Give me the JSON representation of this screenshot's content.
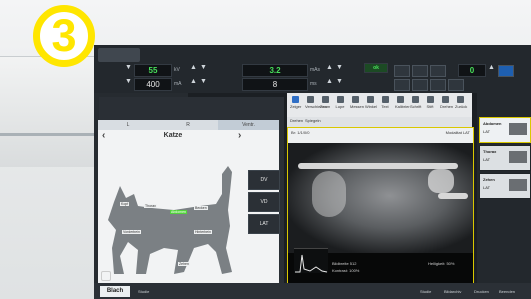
{
  "badge": {
    "number": "3"
  },
  "exposure": {
    "kv_value": "55",
    "kv_unit": "kV",
    "ma_value": "400",
    "ma_unit": "mA",
    "mas_value": "3.2",
    "mas_unit": "mAs",
    "ms_value": "8",
    "ms_unit": "ms",
    "ok_label": "ok",
    "right_value": "0",
    "right_unit": "m"
  },
  "species_panel": {
    "title": "Katze",
    "view_tabs": [
      "L",
      "R",
      "Ventr."
    ],
    "positions": [
      "DV",
      "VD",
      "LAT"
    ],
    "labels": [
      "Kopf",
      "Thorax",
      "Abdomen",
      "Becken",
      "Zehen",
      "Vorderbein",
      "Hinterbein"
    ]
  },
  "toolbar": {
    "tools": [
      "Zeiger",
      "Verschieben",
      "Zoom",
      "Lupe",
      "Messen",
      "Winkel",
      "Text",
      "Kalibrier.",
      "Schrift",
      "Stift",
      "Drehen",
      "Zurück"
    ],
    "secondary": [
      "Drehen",
      "Spiegeln"
    ]
  },
  "viewer": {
    "header_left": "Br: 1/1/0/0",
    "header_right": "Modalitat LAT",
    "stats_left": "Bildbreite 512",
    "stats_mid": "Kontrast: 100%",
    "stats_right": "Helligkeit: 50%"
  },
  "thumbnails": [
    {
      "title": "Abdomen",
      "view": "LAT",
      "selected": true
    },
    {
      "title": "Thorax",
      "view": "LAT",
      "selected": false
    },
    {
      "title": "Zehen",
      "view": "LAT",
      "selected": false
    }
  ],
  "status": {
    "user": "Blach",
    "study_label": "Studie",
    "bottom_right_1": "Studie",
    "bottom_right_2": "Bildarchiv",
    "bottom_right_3": "Drucken",
    "bottom_right_4": "Beenden"
  }
}
